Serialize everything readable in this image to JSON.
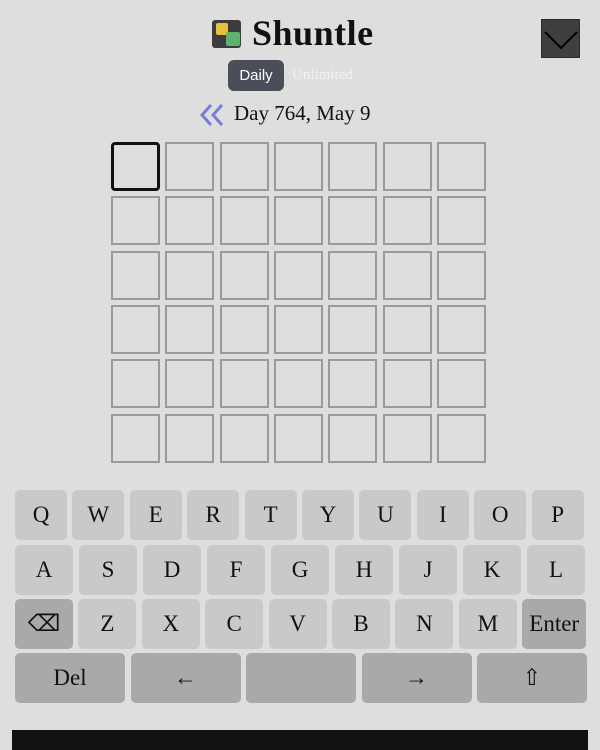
{
  "app": {
    "title": "Shuntle",
    "logo_icon": "game-logo-icon",
    "menu_icon": "chevron-down-icon"
  },
  "modes": {
    "daily_label": "Daily",
    "unlimited_label": "Unlimited",
    "active": "Daily"
  },
  "day": {
    "back_icon": "double-chevron-left-icon",
    "label": "Day 764, May 9"
  },
  "board": {
    "rows": 6,
    "cols": 7,
    "active_cell": {
      "row": 1,
      "col": 1
    },
    "letters": [
      [
        "",
        "",
        "",
        "",
        "",
        "",
        ""
      ],
      [
        "",
        "",
        "",
        "",
        "",
        "",
        ""
      ],
      [
        "",
        "",
        "",
        "",
        "",
        "",
        ""
      ],
      [
        "",
        "",
        "",
        "",
        "",
        "",
        ""
      ],
      [
        "",
        "",
        "",
        "",
        "",
        "",
        ""
      ],
      [
        "",
        "",
        "",
        "",
        "",
        "",
        ""
      ]
    ]
  },
  "keyboard": {
    "row1": [
      "Q",
      "W",
      "E",
      "R",
      "T",
      "Y",
      "U",
      "I",
      "O",
      "P"
    ],
    "row2": [
      "A",
      "S",
      "D",
      "F",
      "G",
      "H",
      "J",
      "K",
      "L"
    ],
    "row3": [
      "⌫",
      "Z",
      "X",
      "C",
      "V",
      "B",
      "N",
      "M",
      "Enter"
    ],
    "row4": [
      "Del",
      "←",
      "",
      "→",
      "⇧"
    ]
  },
  "colors": {
    "background": "#dedede",
    "key": "#c9c9c9",
    "key_dark": "#a9a9a9",
    "tab_active": "#4a4e58",
    "back_icon": "#7b7bdc",
    "logo_yellow": "#e7c13b",
    "logo_green": "#5fb26b"
  }
}
